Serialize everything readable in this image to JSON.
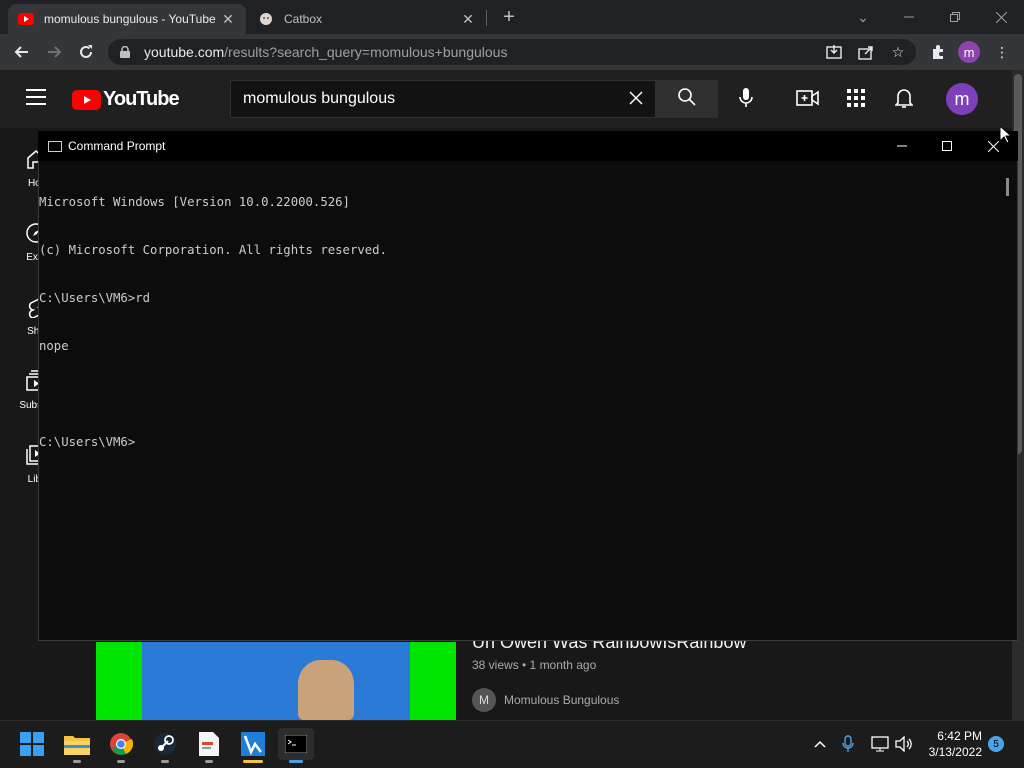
{
  "browser": {
    "tabs": [
      {
        "title": "momulous bungulous - YouTube",
        "active": true,
        "icon": "youtube-icon"
      },
      {
        "title": "Catbox",
        "active": false,
        "icon": "catbox-icon"
      }
    ],
    "url_host": "youtube.com",
    "url_path": "/results?search_query=momulous+bungulous",
    "profile_initial": "m"
  },
  "youtube": {
    "logo_text": "YouTube",
    "search_value": "momulous bungulous",
    "avatar_initial": "m",
    "sidebar": [
      {
        "label": "Hor",
        "icon": "home-icon"
      },
      {
        "label": "Expl",
        "icon": "explore-icon"
      },
      {
        "label": "Sho",
        "icon": "shorts-icon"
      },
      {
        "label": "Subscri",
        "icon": "subscriptions-icon"
      },
      {
        "label": "Libr",
        "icon": "library-icon"
      }
    ],
    "video": {
      "title": "Uh Owen Was RainbowIsRainbow",
      "meta": "38 views • 1 month ago",
      "channel": "Momulous Bungulous",
      "channel_initial": "M"
    }
  },
  "cmd": {
    "title": "Command Prompt",
    "lines": [
      "Microsoft Windows [Version 10.0.22000.526]",
      "(c) Microsoft Corporation. All rights reserved.",
      "C:\\Users\\VM6>rd",
      "nope",
      "",
      "C:\\Users\\VM6>"
    ]
  },
  "taskbar": {
    "time": "6:42 PM",
    "date": "3/13/2022",
    "notification_count": "5"
  },
  "colors": {
    "youtube_red": "#ff0000",
    "accent": "#4aa3e6"
  }
}
